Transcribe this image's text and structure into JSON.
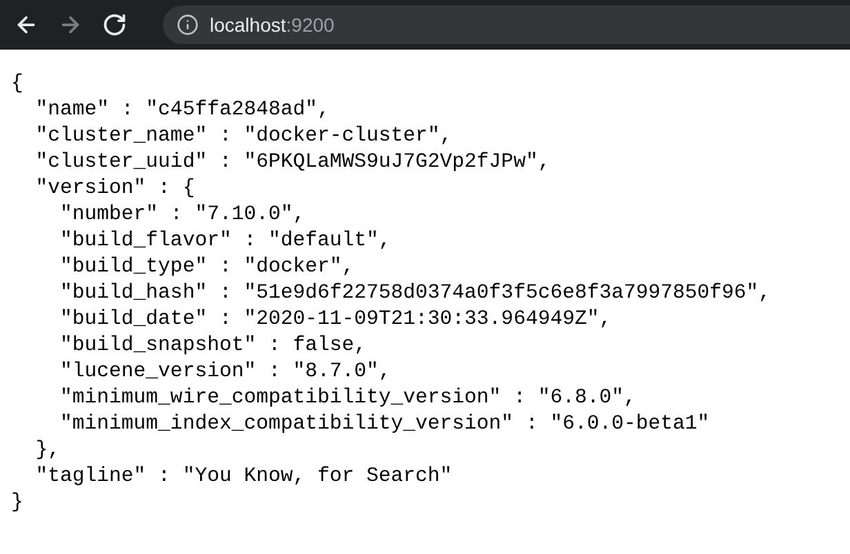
{
  "toolbar": {
    "nav_buttons": [
      {
        "kind": "back",
        "disabled": false
      },
      {
        "kind": "forward",
        "disabled": true
      },
      {
        "kind": "reload",
        "disabled": false
      }
    ],
    "address": {
      "host": "localhost",
      "port": ":9200"
    }
  },
  "document": {
    "lines": [
      "{",
      "  \"name\" : \"c45ffa2848ad\",",
      "  \"cluster_name\" : \"docker-cluster\",",
      "  \"cluster_uuid\" : \"6PKQLaMWS9uJ7G2Vp2fJPw\",",
      "  \"version\" : {",
      "    \"number\" : \"7.10.0\",",
      "    \"build_flavor\" : \"default\",",
      "    \"build_type\" : \"docker\",",
      "    \"build_hash\" : \"51e9d6f22758d0374a0f3f5c6e8f3a7997850f96\",",
      "    \"build_date\" : \"2020-11-09T21:30:33.964949Z\",",
      "    \"build_snapshot\" : false,",
      "    \"lucene_version\" : \"8.7.0\",",
      "    \"minimum_wire_compatibility_version\" : \"6.8.0\",",
      "    \"minimum_index_compatibility_version\" : \"6.0.0-beta1\"",
      "  },",
      "  \"tagline\" : \"You Know, for Search\"",
      "}"
    ]
  }
}
